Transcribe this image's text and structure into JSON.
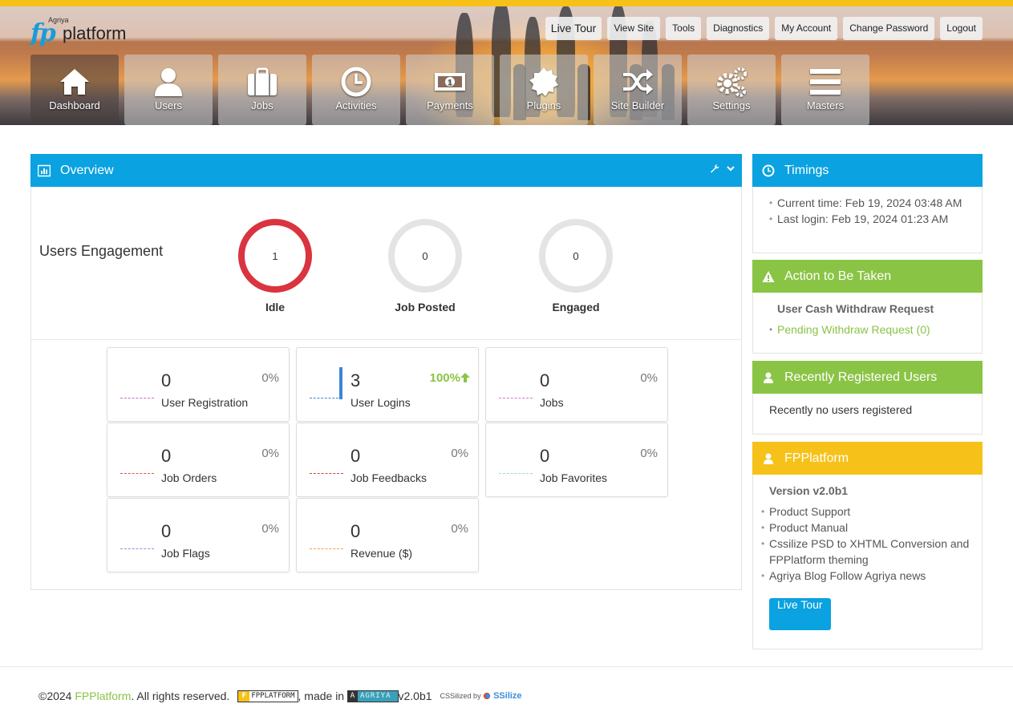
{
  "header": {
    "logo": {
      "fp": "fp",
      "brand_small": "Agriya",
      "platform": "platform"
    },
    "top_nav": [
      "Live Tour",
      "View Site",
      "Tools",
      "Diagnostics",
      "My Account",
      "Change Password",
      "Logout"
    ],
    "main_nav": [
      {
        "label": "Dashboard",
        "icon": "home-icon"
      },
      {
        "label": "Users",
        "icon": "user-icon"
      },
      {
        "label": "Jobs",
        "icon": "briefcase-icon"
      },
      {
        "label": "Activities",
        "icon": "clock-icon"
      },
      {
        "label": "Payments",
        "icon": "money-icon"
      },
      {
        "label": "Plugins",
        "icon": "plugin-badge-icon"
      },
      {
        "label": "Site Builder",
        "icon": "shuffle-icon"
      },
      {
        "label": "Settings",
        "icon": "gears-icon"
      },
      {
        "label": "Masters",
        "icon": "menu-bars-icon"
      }
    ],
    "accent_color": "#f6c21a"
  },
  "overview": {
    "title": "Overview",
    "engagement_title": "Users Engagement",
    "rings": [
      {
        "value": "1",
        "label": "Idle",
        "color": "#d9343f"
      },
      {
        "value": "0",
        "label": "Job Posted",
        "color": "#e4e4e4"
      },
      {
        "value": "0",
        "label": "Engaged",
        "color": "#e4e4e4"
      }
    ],
    "stats": [
      {
        "value": "3",
        "label": "User Logins",
        "pct": "100%",
        "trend": "up",
        "spark_color": "#3b86d8"
      },
      {
        "value": "0",
        "label": "User Registration",
        "pct": "0%",
        "spark_color": "#c46fc0"
      },
      {
        "value": "0",
        "label": "Jobs",
        "pct": "0%",
        "spark_color": "#d078c8"
      },
      {
        "value": "0",
        "label": "Job Orders",
        "pct": "0%",
        "spark_color": "#d9534f"
      },
      {
        "value": "0",
        "label": "Job Feedbacks",
        "pct": "0%",
        "spark_color": "#c9483f"
      },
      {
        "value": "0",
        "label": "Job Favorites",
        "pct": "0%",
        "spark_color": "#9fd6e0"
      },
      {
        "value": "0",
        "label": "Job Flags",
        "pct": "0%",
        "spark_color": "#9b8fd8"
      },
      {
        "value": "0",
        "label": "Revenue ($)",
        "pct": "0%",
        "spark_color": "#f0a04b"
      }
    ]
  },
  "timings": {
    "title": "Timings",
    "current_time": "Current time: Feb 19, 2024 03:48 AM",
    "last_login": "Last login: Feb 19, 2024 01:23 AM"
  },
  "action": {
    "title": "Action to Be Taken",
    "subtitle": "User Cash Withdraw Request",
    "link": "Pending Withdraw Request (0)"
  },
  "recent_users": {
    "title": "Recently Registered Users",
    "text": "Recently no users registered"
  },
  "fpplatform": {
    "title": "FPPlatform",
    "version": "Version v2.0b1",
    "links": [
      "Product Support",
      "Product Manual",
      "Cssilize PSD to XHTML Conversion and FPPlatform theming",
      "Agriya Blog Follow Agriya news"
    ],
    "button": "Live Tour"
  },
  "footer": {
    "copyright": "©2024",
    "brand": "FPPlatform",
    "rights": ". All rights reserved.",
    "badge_fp": "FPPLATFORM",
    "made_in": ", made in",
    "badge_agriya": "AGRIYA",
    "version": "v2.0b1",
    "cssilized_by": "CSSilized by",
    "cssilize": "SSilize"
  }
}
